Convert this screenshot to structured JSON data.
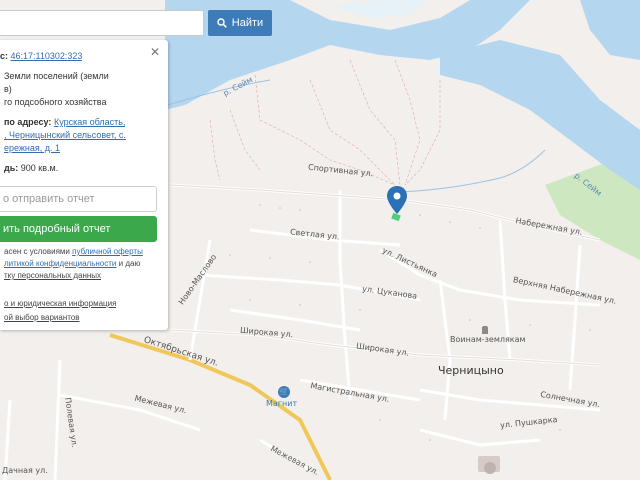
{
  "search": {
    "value": "",
    "button_label": "Найти"
  },
  "panel": {
    "cadastre_label": "с:",
    "cadastre_number": "46:17:110302:323",
    "category_line1": "Земли поселений (земли",
    "category_line2": "в)",
    "use_line": "го подсобного хозяйства",
    "address_label": "по адресу:",
    "address_link1": "Курская область,",
    "address_link2": ", Черницынский сельсовет, с.",
    "address_link3": "ережная, д. 1",
    "area_label": "дь:",
    "area_value": "900 кв.м.",
    "report_placeholder": "о отправить отчет",
    "report_button": "ить подробный отчет",
    "consent_line1_a": "асен с условиями",
    "consent_line1_link": "публичной оферты",
    "consent_line2_link": "литикой конфиденциальности",
    "consent_line2_b": "и даю",
    "consent_line3_link": "тку персональных данных",
    "legal_link": "о и юридическая информация",
    "variants_link": "ой выбор вариантов"
  },
  "map": {
    "river_labels": [
      "р. Сейм",
      "р. Сейм"
    ],
    "streets": [
      "Спортивная ул.",
      "Светлая ул.",
      "Набережная ул.",
      "Ново-Маслово",
      "ул. Листьянка",
      "ул. Цуканова",
      "Верхняя Набережная ул.",
      "Широкая ул.",
      "Широкая ул.",
      "Октябрьская ул.",
      "Магистральная ул.",
      "Межевая ул.",
      "Полевая ул.",
      "Солнечная ул.",
      "ул. Пушкарка",
      "Межевая ул.",
      "Дачная ул."
    ],
    "poi_monument": "Воинам-землякам",
    "poi_shop": "Магнит",
    "town": "Черницыно"
  },
  "colors": {
    "water": "#b5d6ef",
    "land": "#f3efec",
    "forest": "#cde8c0",
    "primary_button": "#3d7bb9",
    "report_button": "#3ca84c",
    "marker": "#2b71b8",
    "road_main": "#f0c85a"
  }
}
